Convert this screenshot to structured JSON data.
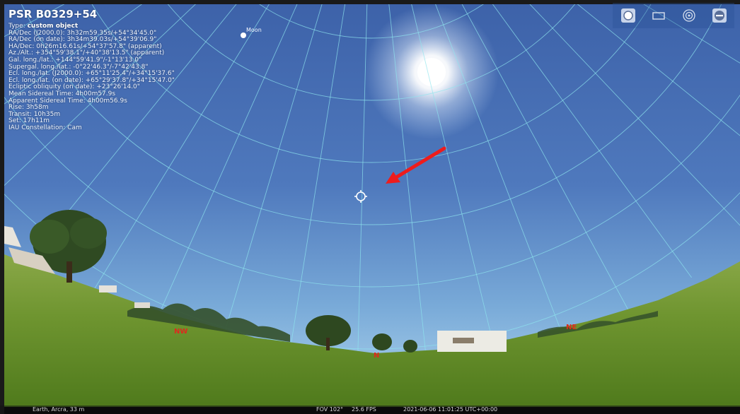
{
  "window": {
    "border_color": "#1a1a1a"
  },
  "object": {
    "name": "PSR B0329+54",
    "type_label": "Type:",
    "type_value": "custom object",
    "info_lines": [
      "RA/Dec (J2000.0): 3h32m59.35s/+54°34'45.0\"",
      "RA/Dec (on date): 3h34m39.03s/+54°39'06.9\"",
      "HA/Dec: 0h26m16.61s/+54°37'57.8\" (apparent)",
      "Az./Alt.: +354°59'38.1\"/+40°38'13.5\" (apparent)",
      "Gal. long./lat.: +144°59'41.9\"/-1°13'13.0\"",
      "Supergal. long./lat.: -0°22'46.3\"/-7°42'43.8\"",
      "Ecl. long./lat. (J2000.0): +65°11'25.4\"/+34°15'37.6\"",
      "Ecl. long./lat. (on date): +65°29'37.8\"/+34°15'47.0\"",
      "Ecliptic obliquity (on date): +23°26'14.0\"",
      "Mean Sidereal Time: 4h00m57.9s",
      "Apparent Sidereal Time: 4h00m56.9s",
      "Rise: 3h58m",
      "Transit: 10h35m",
      "Set: 17h11m",
      "IAU Constellation: Cam"
    ]
  },
  "sky": {
    "moon_label": "Moon",
    "cardinals": {
      "nw": "NW",
      "n": "N",
      "ne": "NE"
    },
    "colors": {
      "zenith": "#3f66ad",
      "horizon": "#a8d2ec",
      "grid": "#8fe6ee",
      "sun": "#ffffff",
      "cardinal": "#dd2a1e",
      "arrow": "#ee1c1c",
      "grass_near": "#5d8a22",
      "grass_far": "#8aa848",
      "trees": "#2f4a22"
    },
    "icons": [
      "sun-icon",
      "moon-icon",
      "selected-object-marker-icon",
      "pointer-arrow-icon"
    ]
  },
  "toolbar": {
    "buttons": [
      {
        "name": "circle-button",
        "icon": "circle-icon"
      },
      {
        "name": "rectangle-button",
        "icon": "rectangle-icon"
      },
      {
        "name": "target-button",
        "icon": "target-icon"
      },
      {
        "name": "exit-button",
        "icon": "exit-icon"
      }
    ]
  },
  "status": {
    "location": "Earth, Arcra, 33 m",
    "fov": "FOV 102°",
    "fps": "25.6 FPS",
    "datetime": "2021-06-06 11:01:25 UTC+00:00"
  }
}
